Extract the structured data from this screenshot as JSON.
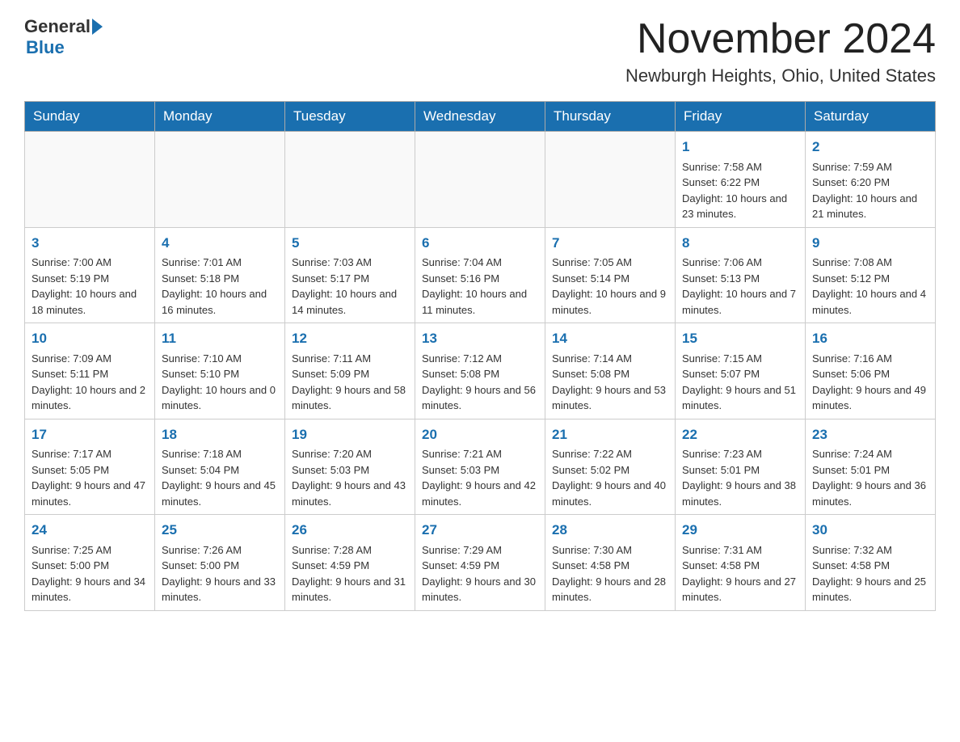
{
  "header": {
    "logo": {
      "general": "General",
      "blue": "Blue"
    },
    "title": "November 2024",
    "location": "Newburgh Heights, Ohio, United States"
  },
  "days_of_week": [
    "Sunday",
    "Monday",
    "Tuesday",
    "Wednesday",
    "Thursday",
    "Friday",
    "Saturday"
  ],
  "weeks": [
    [
      {
        "day": "",
        "sunrise": "",
        "sunset": "",
        "daylight": ""
      },
      {
        "day": "",
        "sunrise": "",
        "sunset": "",
        "daylight": ""
      },
      {
        "day": "",
        "sunrise": "",
        "sunset": "",
        "daylight": ""
      },
      {
        "day": "",
        "sunrise": "",
        "sunset": "",
        "daylight": ""
      },
      {
        "day": "",
        "sunrise": "",
        "sunset": "",
        "daylight": ""
      },
      {
        "day": "1",
        "sunrise": "Sunrise: 7:58 AM",
        "sunset": "Sunset: 6:22 PM",
        "daylight": "Daylight: 10 hours and 23 minutes."
      },
      {
        "day": "2",
        "sunrise": "Sunrise: 7:59 AM",
        "sunset": "Sunset: 6:20 PM",
        "daylight": "Daylight: 10 hours and 21 minutes."
      }
    ],
    [
      {
        "day": "3",
        "sunrise": "Sunrise: 7:00 AM",
        "sunset": "Sunset: 5:19 PM",
        "daylight": "Daylight: 10 hours and 18 minutes."
      },
      {
        "day": "4",
        "sunrise": "Sunrise: 7:01 AM",
        "sunset": "Sunset: 5:18 PM",
        "daylight": "Daylight: 10 hours and 16 minutes."
      },
      {
        "day": "5",
        "sunrise": "Sunrise: 7:03 AM",
        "sunset": "Sunset: 5:17 PM",
        "daylight": "Daylight: 10 hours and 14 minutes."
      },
      {
        "day": "6",
        "sunrise": "Sunrise: 7:04 AM",
        "sunset": "Sunset: 5:16 PM",
        "daylight": "Daylight: 10 hours and 11 minutes."
      },
      {
        "day": "7",
        "sunrise": "Sunrise: 7:05 AM",
        "sunset": "Sunset: 5:14 PM",
        "daylight": "Daylight: 10 hours and 9 minutes."
      },
      {
        "day": "8",
        "sunrise": "Sunrise: 7:06 AM",
        "sunset": "Sunset: 5:13 PM",
        "daylight": "Daylight: 10 hours and 7 minutes."
      },
      {
        "day": "9",
        "sunrise": "Sunrise: 7:08 AM",
        "sunset": "Sunset: 5:12 PM",
        "daylight": "Daylight: 10 hours and 4 minutes."
      }
    ],
    [
      {
        "day": "10",
        "sunrise": "Sunrise: 7:09 AM",
        "sunset": "Sunset: 5:11 PM",
        "daylight": "Daylight: 10 hours and 2 minutes."
      },
      {
        "day": "11",
        "sunrise": "Sunrise: 7:10 AM",
        "sunset": "Sunset: 5:10 PM",
        "daylight": "Daylight: 10 hours and 0 minutes."
      },
      {
        "day": "12",
        "sunrise": "Sunrise: 7:11 AM",
        "sunset": "Sunset: 5:09 PM",
        "daylight": "Daylight: 9 hours and 58 minutes."
      },
      {
        "day": "13",
        "sunrise": "Sunrise: 7:12 AM",
        "sunset": "Sunset: 5:08 PM",
        "daylight": "Daylight: 9 hours and 56 minutes."
      },
      {
        "day": "14",
        "sunrise": "Sunrise: 7:14 AM",
        "sunset": "Sunset: 5:08 PM",
        "daylight": "Daylight: 9 hours and 53 minutes."
      },
      {
        "day": "15",
        "sunrise": "Sunrise: 7:15 AM",
        "sunset": "Sunset: 5:07 PM",
        "daylight": "Daylight: 9 hours and 51 minutes."
      },
      {
        "day": "16",
        "sunrise": "Sunrise: 7:16 AM",
        "sunset": "Sunset: 5:06 PM",
        "daylight": "Daylight: 9 hours and 49 minutes."
      }
    ],
    [
      {
        "day": "17",
        "sunrise": "Sunrise: 7:17 AM",
        "sunset": "Sunset: 5:05 PM",
        "daylight": "Daylight: 9 hours and 47 minutes."
      },
      {
        "day": "18",
        "sunrise": "Sunrise: 7:18 AM",
        "sunset": "Sunset: 5:04 PM",
        "daylight": "Daylight: 9 hours and 45 minutes."
      },
      {
        "day": "19",
        "sunrise": "Sunrise: 7:20 AM",
        "sunset": "Sunset: 5:03 PM",
        "daylight": "Daylight: 9 hours and 43 minutes."
      },
      {
        "day": "20",
        "sunrise": "Sunrise: 7:21 AM",
        "sunset": "Sunset: 5:03 PM",
        "daylight": "Daylight: 9 hours and 42 minutes."
      },
      {
        "day": "21",
        "sunrise": "Sunrise: 7:22 AM",
        "sunset": "Sunset: 5:02 PM",
        "daylight": "Daylight: 9 hours and 40 minutes."
      },
      {
        "day": "22",
        "sunrise": "Sunrise: 7:23 AM",
        "sunset": "Sunset: 5:01 PM",
        "daylight": "Daylight: 9 hours and 38 minutes."
      },
      {
        "day": "23",
        "sunrise": "Sunrise: 7:24 AM",
        "sunset": "Sunset: 5:01 PM",
        "daylight": "Daylight: 9 hours and 36 minutes."
      }
    ],
    [
      {
        "day": "24",
        "sunrise": "Sunrise: 7:25 AM",
        "sunset": "Sunset: 5:00 PM",
        "daylight": "Daylight: 9 hours and 34 minutes."
      },
      {
        "day": "25",
        "sunrise": "Sunrise: 7:26 AM",
        "sunset": "Sunset: 5:00 PM",
        "daylight": "Daylight: 9 hours and 33 minutes."
      },
      {
        "day": "26",
        "sunrise": "Sunrise: 7:28 AM",
        "sunset": "Sunset: 4:59 PM",
        "daylight": "Daylight: 9 hours and 31 minutes."
      },
      {
        "day": "27",
        "sunrise": "Sunrise: 7:29 AM",
        "sunset": "Sunset: 4:59 PM",
        "daylight": "Daylight: 9 hours and 30 minutes."
      },
      {
        "day": "28",
        "sunrise": "Sunrise: 7:30 AM",
        "sunset": "Sunset: 4:58 PM",
        "daylight": "Daylight: 9 hours and 28 minutes."
      },
      {
        "day": "29",
        "sunrise": "Sunrise: 7:31 AM",
        "sunset": "Sunset: 4:58 PM",
        "daylight": "Daylight: 9 hours and 27 minutes."
      },
      {
        "day": "30",
        "sunrise": "Sunrise: 7:32 AM",
        "sunset": "Sunset: 4:58 PM",
        "daylight": "Daylight: 9 hours and 25 minutes."
      }
    ]
  ]
}
